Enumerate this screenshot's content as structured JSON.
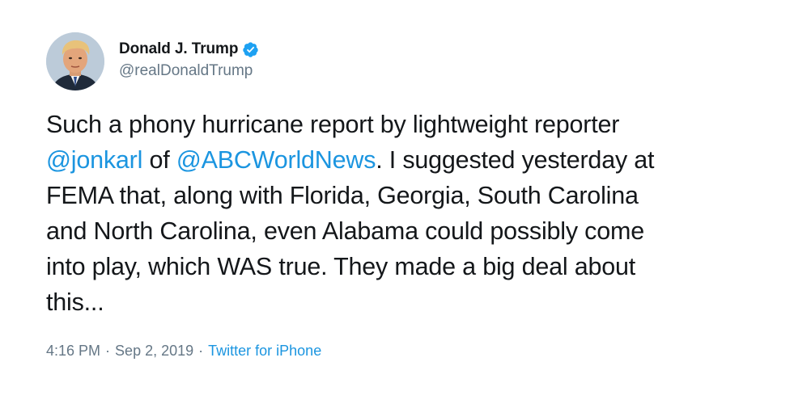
{
  "author": {
    "display_name": "Donald J. Trump",
    "handle": "@realDonaldTrump",
    "verified_icon": "verified-badge-icon",
    "avatar_icon": "profile-photo"
  },
  "tweet": {
    "lines": [
      [
        {
          "text": "Such a phony hurricane report by lightweight reporter"
        }
      ],
      [
        {
          "text": "@jonkarl",
          "mention": true
        },
        {
          "text": " of "
        },
        {
          "text": "@ABCWorldNews",
          "mention": true
        },
        {
          "text": ". I suggested yesterday at"
        }
      ],
      [
        {
          "text": "FEMA that, along with Florida, Georgia, South Carolina"
        }
      ],
      [
        {
          "text": "and North Carolina, even Alabama could possibly come"
        }
      ],
      [
        {
          "text": "into play, which WAS true. They made a big deal about"
        }
      ],
      [
        {
          "text": "this..."
        }
      ]
    ]
  },
  "meta": {
    "time": "4:16 PM",
    "date": "Sep 2, 2019",
    "separator": "·",
    "source": "Twitter for iPhone"
  },
  "colors": {
    "link": "#1b95e0",
    "secondary_text": "#657786",
    "primary_text": "#14171a",
    "verified": "#1da1f2"
  }
}
